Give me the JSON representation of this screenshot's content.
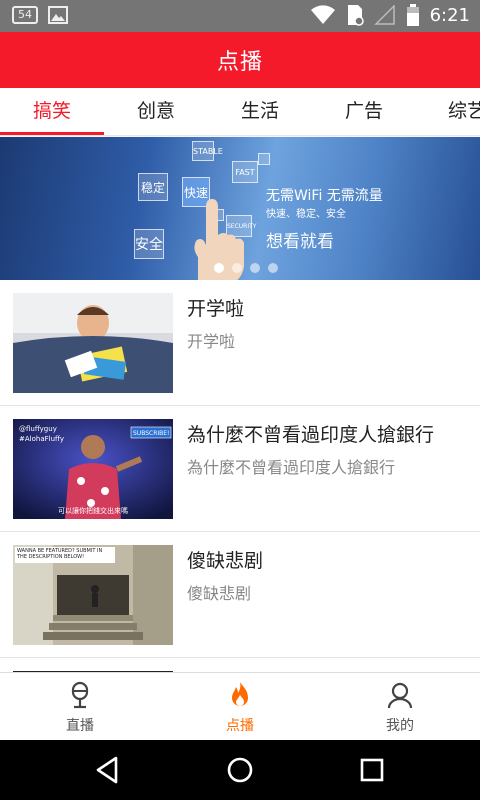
{
  "status_bar": {
    "notification_count": "54",
    "time": "6:21"
  },
  "app_bar": {
    "title": "点播"
  },
  "tabs": [
    {
      "label": "搞笑",
      "active": true
    },
    {
      "label": "创意",
      "active": false
    },
    {
      "label": "生活",
      "active": false
    },
    {
      "label": "广告",
      "active": false
    },
    {
      "label": "综艺",
      "active": false
    }
  ],
  "banner": {
    "chips": [
      "稳定",
      "快速",
      "安全",
      "STABLE",
      "FAST",
      "SECURITY"
    ],
    "line1": "无需WiFi  无需流量",
    "line2": "快速、稳定、安全",
    "line3": "想看就看",
    "page_count": 4,
    "current_page": 1
  },
  "videos": [
    {
      "title": "开学啦",
      "subtitle": "开学啦"
    },
    {
      "title": "為什麼不曾看過印度人搶銀行",
      "subtitle": "為什麼不曾看過印度人搶銀行",
      "thumb_tag1": "@fluffyguy",
      "thumb_tag2": "#AlohaFluffy",
      "thumb_button": "SUBSCRIBE!",
      "thumb_caption": "可以讓你把錢交出來嗎"
    },
    {
      "title": "傻缺悲剧",
      "subtitle": "傻缺悲剧",
      "thumb_caption": "WANNA BE FEATURED? SUBMIT IN THE DESCRIPTION BELOW!"
    }
  ],
  "bottom_nav": [
    {
      "label": "直播",
      "icon": "microphone-icon",
      "active": false
    },
    {
      "label": "点播",
      "icon": "flame-icon",
      "active": true
    },
    {
      "label": "我的",
      "icon": "person-icon",
      "active": false
    }
  ],
  "colors": {
    "brand_red": "#f41a2a",
    "active_orange": "#ff6a00",
    "status_bar": "#757575"
  }
}
